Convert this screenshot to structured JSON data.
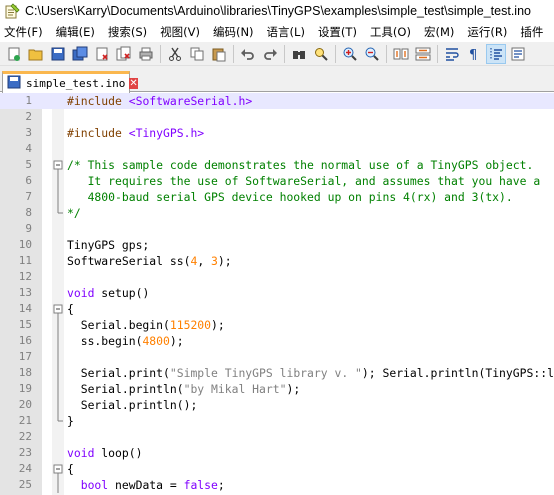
{
  "window": {
    "title": "C:\\Users\\Karry\\Documents\\Arduino\\libraries\\TinyGPS\\examples\\simple_test\\simple_test.ino"
  },
  "menu": [
    "文件(F)",
    "编辑(E)",
    "搜索(S)",
    "视图(V)",
    "编码(N)",
    "语言(L)",
    "设置(T)",
    "工具(O)",
    "宏(M)",
    "运行(R)",
    "插件"
  ],
  "toolbar": {
    "icons": [
      "new-file-icon",
      "open-file-icon",
      "save-icon",
      "save-all-icon",
      "close-icon",
      "close-all-icon",
      "print-icon",
      "cut-icon",
      "copy-icon",
      "paste-icon",
      "undo-icon",
      "redo-icon",
      "find-icon",
      "replace-icon",
      "zoom-in-icon",
      "zoom-out-icon",
      "sync-vertical-icon",
      "sync-horizontal-icon",
      "word-wrap-icon",
      "show-all-chars-icon",
      "indent-guide-icon",
      "user-defined-icon"
    ],
    "active_icon": "indent-guide-icon"
  },
  "tab": {
    "label": "simple_test.ino",
    "close": "✕"
  },
  "editor": {
    "current_line": 1,
    "lines": [
      {
        "n": "1",
        "fold": "",
        "tokens": [
          {
            "c": "pre",
            "t": "#include "
          },
          {
            "c": "inc",
            "t": "<SoftwareSerial.h>"
          }
        ]
      },
      {
        "n": "2",
        "fold": "",
        "tokens": []
      },
      {
        "n": "3",
        "fold": "",
        "tokens": [
          {
            "c": "pre",
            "t": "#include "
          },
          {
            "c": "inc",
            "t": "<TinyGPS.h>"
          }
        ]
      },
      {
        "n": "4",
        "fold": "",
        "tokens": []
      },
      {
        "n": "5",
        "fold": "open",
        "tokens": [
          {
            "c": "com",
            "t": "/* This sample code demonstrates the normal use of a TinyGPS object."
          }
        ]
      },
      {
        "n": "6",
        "fold": "line",
        "tokens": [
          {
            "c": "com",
            "t": "   It requires the use of SoftwareSerial, and assumes that you have a"
          }
        ]
      },
      {
        "n": "7",
        "fold": "line",
        "tokens": [
          {
            "c": "com",
            "t": "   4800-baud serial GPS device hooked up on pins 4(rx) and 3(tx)."
          }
        ]
      },
      {
        "n": "8",
        "fold": "end",
        "tokens": [
          {
            "c": "com",
            "t": "*/"
          }
        ]
      },
      {
        "n": "9",
        "fold": "",
        "tokens": []
      },
      {
        "n": "10",
        "fold": "",
        "tokens": [
          {
            "c": "",
            "t": "TinyGPS gps;"
          }
        ]
      },
      {
        "n": "11",
        "fold": "",
        "tokens": [
          {
            "c": "",
            "t": "SoftwareSerial ss("
          },
          {
            "c": "num",
            "t": "4"
          },
          {
            "c": "",
            "t": ", "
          },
          {
            "c": "num",
            "t": "3"
          },
          {
            "c": "",
            "t": ");"
          }
        ]
      },
      {
        "n": "12",
        "fold": "",
        "tokens": []
      },
      {
        "n": "13",
        "fold": "",
        "tokens": [
          {
            "c": "kw",
            "t": "void"
          },
          {
            "c": "",
            "t": " setup()"
          }
        ]
      },
      {
        "n": "14",
        "fold": "open",
        "tokens": [
          {
            "c": "",
            "t": "{"
          }
        ]
      },
      {
        "n": "15",
        "fold": "line",
        "tokens": [
          {
            "c": "",
            "t": "  Serial.begin("
          },
          {
            "c": "num",
            "t": "115200"
          },
          {
            "c": "",
            "t": ");"
          }
        ]
      },
      {
        "n": "16",
        "fold": "line",
        "tokens": [
          {
            "c": "",
            "t": "  ss.begin("
          },
          {
            "c": "num",
            "t": "4800"
          },
          {
            "c": "",
            "t": ");"
          }
        ]
      },
      {
        "n": "17",
        "fold": "line",
        "tokens": []
      },
      {
        "n": "18",
        "fold": "line",
        "tokens": [
          {
            "c": "",
            "t": "  Serial.print("
          },
          {
            "c": "str",
            "t": "\"Simple TinyGPS library v. \""
          },
          {
            "c": "",
            "t": "); Serial.println(TinyGPS::library_version());"
          }
        ]
      },
      {
        "n": "19",
        "fold": "line",
        "tokens": [
          {
            "c": "",
            "t": "  Serial.println("
          },
          {
            "c": "str",
            "t": "\"by Mikal Hart\""
          },
          {
            "c": "",
            "t": ");"
          }
        ]
      },
      {
        "n": "20",
        "fold": "line",
        "tokens": [
          {
            "c": "",
            "t": "  Serial.println();"
          }
        ]
      },
      {
        "n": "21",
        "fold": "end",
        "tokens": [
          {
            "c": "",
            "t": "}"
          }
        ]
      },
      {
        "n": "22",
        "fold": "",
        "tokens": []
      },
      {
        "n": "23",
        "fold": "",
        "tokens": [
          {
            "c": "kw",
            "t": "void"
          },
          {
            "c": "",
            "t": " loop()"
          }
        ]
      },
      {
        "n": "24",
        "fold": "open",
        "tokens": [
          {
            "c": "",
            "t": "{"
          }
        ]
      },
      {
        "n": "25",
        "fold": "line",
        "tokens": [
          {
            "c": "",
            "t": "  "
          },
          {
            "c": "kw",
            "t": "bool"
          },
          {
            "c": "",
            "t": " newData = "
          },
          {
            "c": "kw",
            "t": "false"
          },
          {
            "c": "",
            "t": ";"
          }
        ]
      }
    ]
  },
  "colors": {
    "preprocessor": "#804000",
    "include_file": "#8000ff",
    "comment": "#008000",
    "keyword": "#8000ff",
    "number": "#ff8000",
    "string": "#808080",
    "tab_accent": "#fab74e",
    "current_line": "#e8e8ff"
  }
}
